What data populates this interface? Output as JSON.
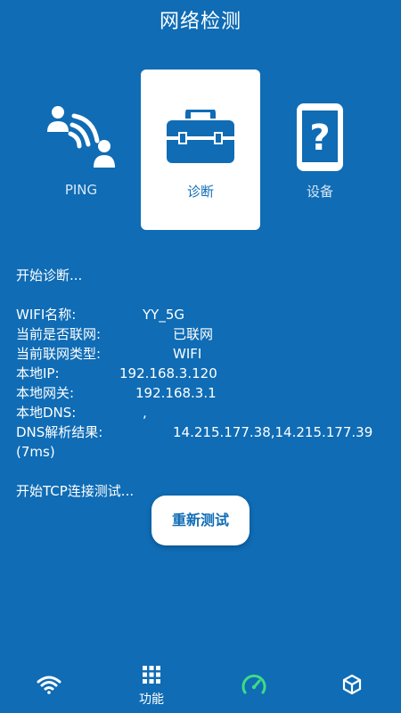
{
  "header": {
    "title": "网络检测"
  },
  "tabs": [
    {
      "label": "PING",
      "icon": "ping-signal-icon",
      "active": false
    },
    {
      "label": "诊断",
      "icon": "toolbox-icon",
      "active": true
    },
    {
      "label": "设备",
      "icon": "device-question-icon",
      "active": false
    }
  ],
  "log": {
    "start": "开始诊断...",
    "rows": {
      "wifi_name": {
        "key": "WIFI名称:",
        "value": "YY_5G"
      },
      "connected": {
        "key": "当前是否联网:",
        "value": "已联网"
      },
      "net_type": {
        "key": "当前联网类型:",
        "value": "WIFI"
      },
      "local_ip": {
        "key": "本地IP:",
        "value": "192.168.3.120"
      },
      "gateway": {
        "key": "本地网关:",
        "value": "192.168.3.1"
      },
      "local_dns": {
        "key": "本地DNS:",
        "value": ","
      },
      "dns_result": {
        "key": "DNS解析结果:",
        "value": "14.215.177.38,14.215.177.39"
      }
    },
    "dns_time": "(7ms)",
    "tcp": "开始TCP连接测试..."
  },
  "retest_button": "重新测试",
  "bottom_nav": {
    "wifi": {
      "icon": "wifi-icon"
    },
    "functions": {
      "label": "功能",
      "icon": "grid-icon"
    },
    "speed": {
      "icon": "speedometer-icon",
      "color": "#3ddc84"
    },
    "box": {
      "icon": "cube-icon"
    }
  },
  "colors": {
    "background": "#0f6cb5",
    "accent_white": "#ffffff",
    "active_green": "#3ddc84"
  }
}
